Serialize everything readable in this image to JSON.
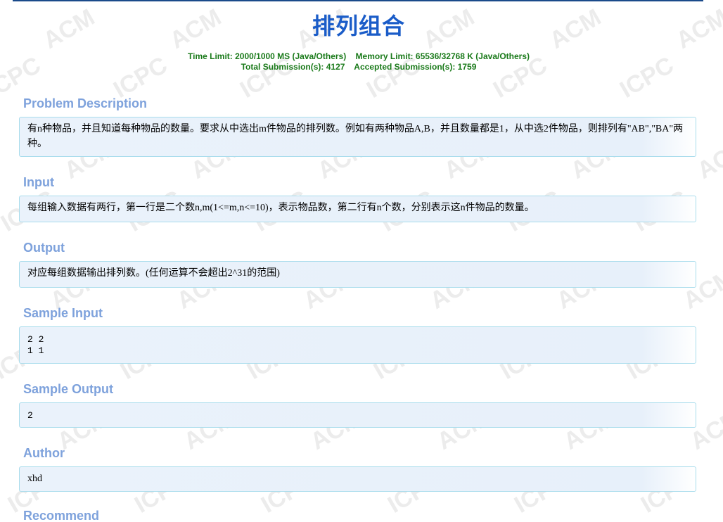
{
  "problem": {
    "title": "排列组合",
    "limits_line": "Time Limit: 2000/1000 MS (Java/Others)    Memory Limit: 65536/32768 K (Java/Others)",
    "submissions_line": "Total Submission(s): 4127    Accepted Submission(s): 1759"
  },
  "sections": {
    "description": {
      "heading": "Problem Description",
      "text": "有n种物品，并且知道每种物品的数量。要求从中选出m件物品的排列数。例如有两种物品A,B，并且数量都是1，从中选2件物品，则排列有\"AB\",\"BA\"两种。"
    },
    "input": {
      "heading": "Input",
      "text": "每组输入数据有两行，第一行是二个数n,m(1<=m,n<=10)，表示物品数，第二行有n个数，分别表示这n件物品的数量。"
    },
    "output": {
      "heading": "Output",
      "text": "对应每组数据输出排列数。(任何运算不会超出2^31的范围)"
    },
    "sample_input": {
      "heading": "Sample Input",
      "text": "2 2\n1 1"
    },
    "sample_output": {
      "heading": "Sample Output",
      "text": "2"
    },
    "author": {
      "heading": "Author",
      "text": "xhd"
    },
    "recommend": {
      "heading": "Recommend"
    }
  },
  "watermark": {
    "words": [
      "ACM",
      "ICPC"
    ],
    "color": "#ececec"
  },
  "colors": {
    "title": "#1a5cc8",
    "info": "#1a7a1a",
    "section_heading": "#7ea2dc",
    "panel_border": "#a8dcec",
    "panel_bg": "#e7f0fa",
    "top_rule": "#1a4a8a"
  }
}
